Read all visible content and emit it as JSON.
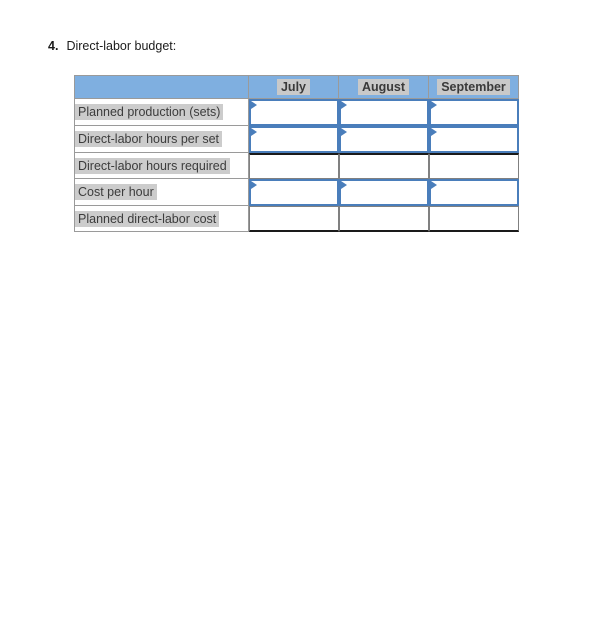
{
  "question": {
    "number": "4.",
    "title": "Direct-labor budget:"
  },
  "table": {
    "corner_header": "",
    "column_headers": [
      "July",
      "August",
      "September"
    ],
    "rows": [
      {
        "label": "Planned production (sets)",
        "kind": "input",
        "cells": [
          "",
          "",
          ""
        ]
      },
      {
        "label": "Direct-labor hours per set",
        "kind": "input",
        "cells": [
          "",
          "",
          ""
        ]
      },
      {
        "label": "Direct-labor hours required",
        "kind": "calculated",
        "cells": [
          "",
          "",
          ""
        ]
      },
      {
        "label": "Cost per hour",
        "kind": "input",
        "cells": [
          "",
          "",
          ""
        ]
      },
      {
        "label": "Planned direct-labor cost",
        "kind": "calculated",
        "cells": [
          "",
          "",
          ""
        ]
      }
    ]
  },
  "colors": {
    "header_blue": "#7fafe0",
    "input_border_blue": "#4a7ebb",
    "label_highlight_gray": "#cccccc",
    "grid_gray": "#9a9a9a",
    "text_dark": "#1c1c1c"
  },
  "icons": {
    "input_marker": "triangle-right-marker-icon"
  }
}
